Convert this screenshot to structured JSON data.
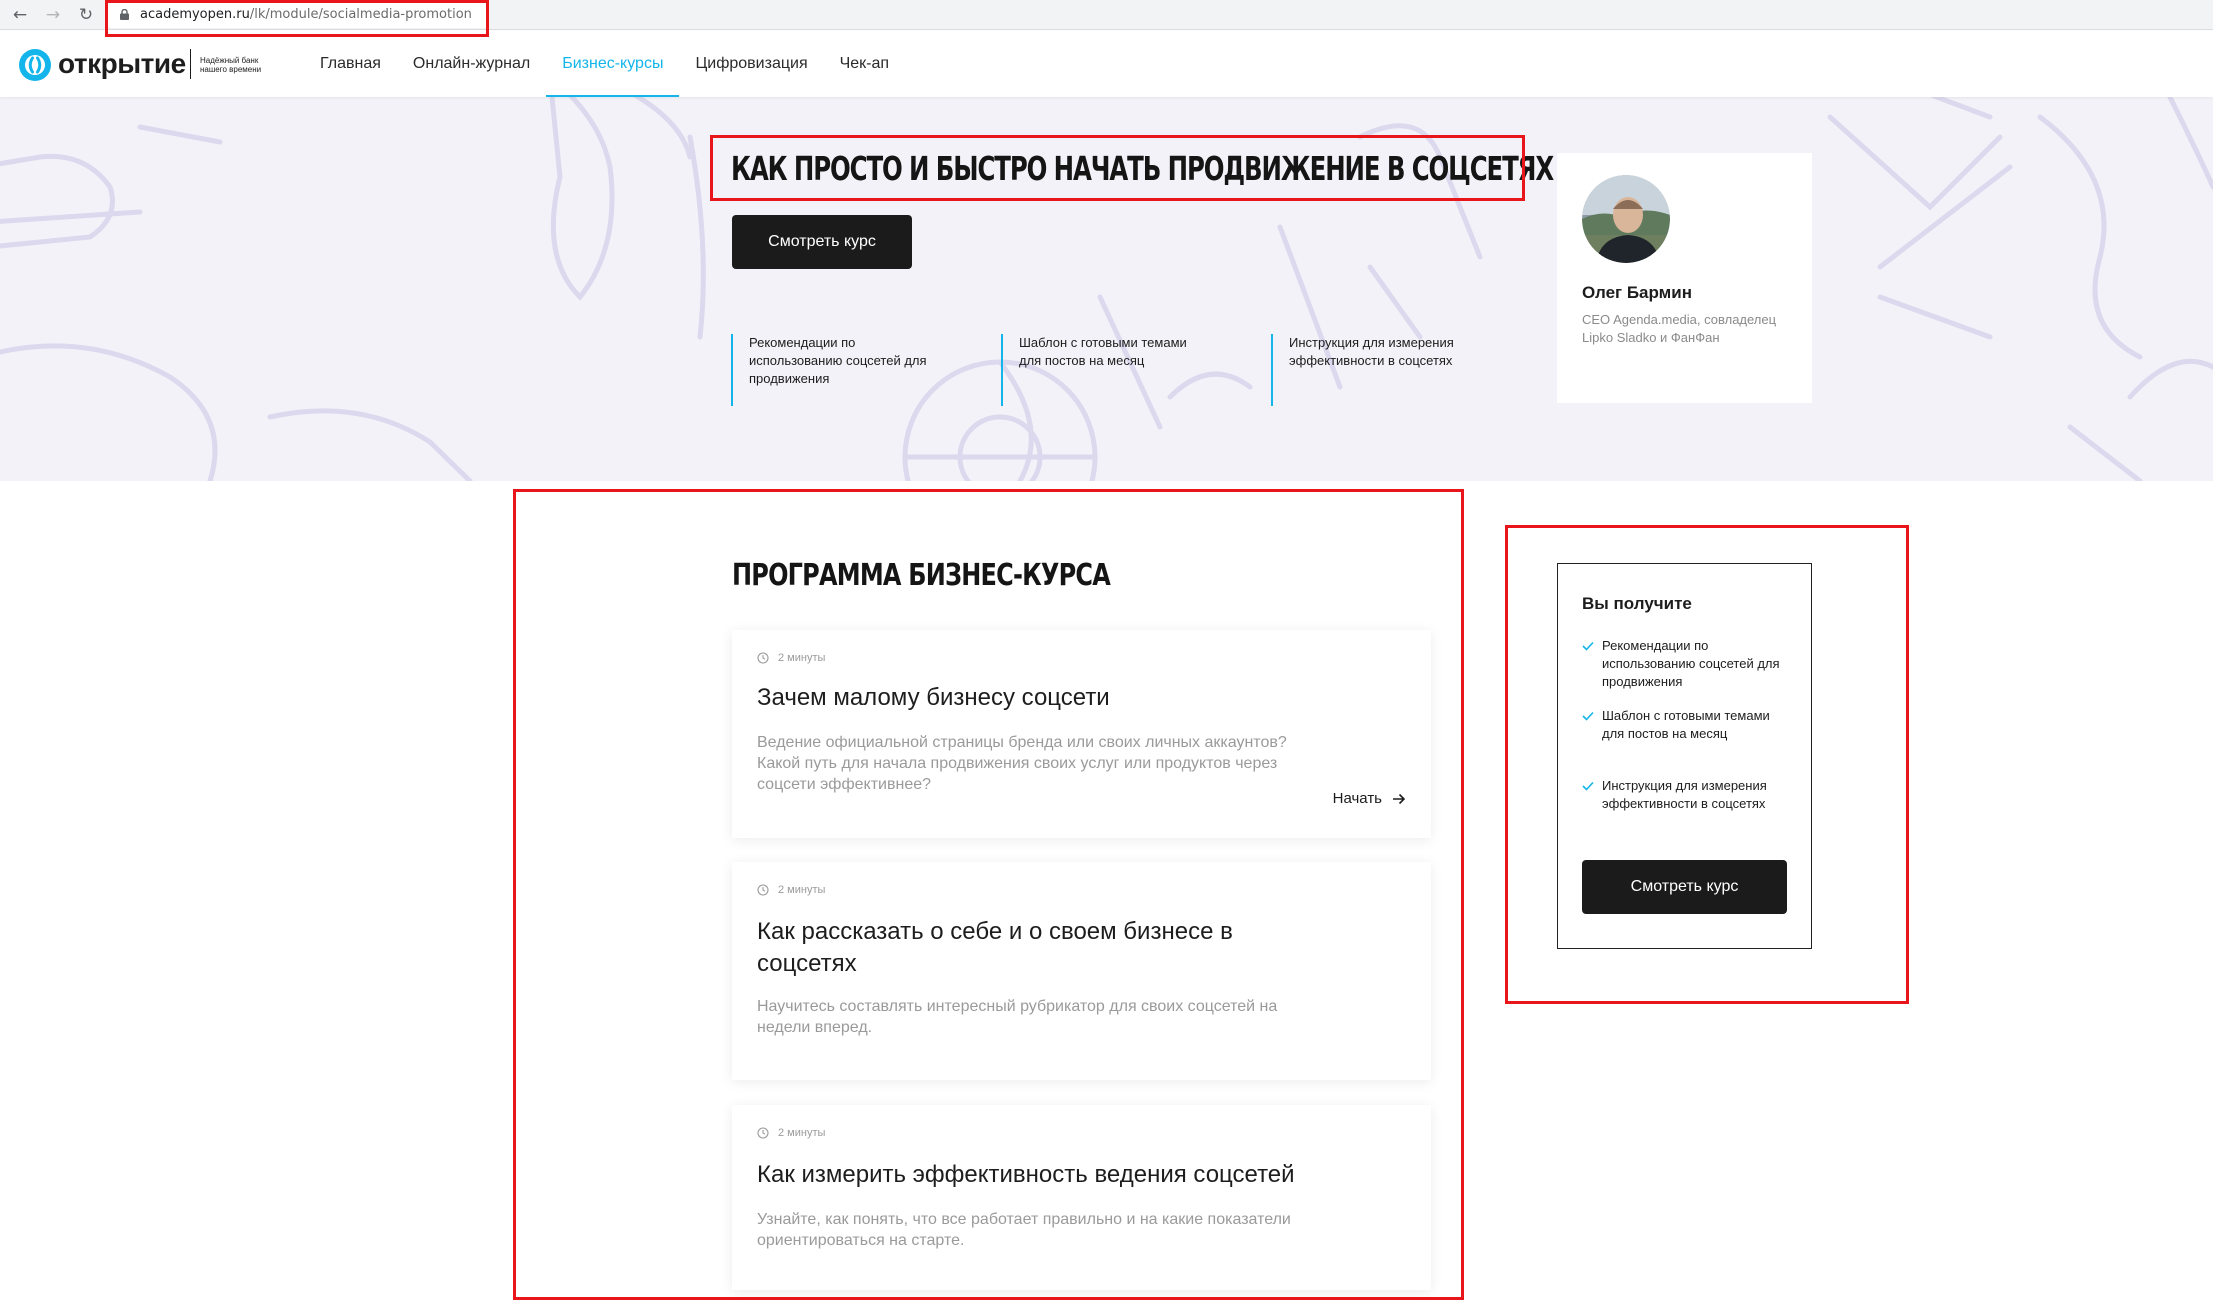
{
  "browser": {
    "url_domain": "academyopen.ru",
    "url_path": "/lk/module/socialmedia-promotion"
  },
  "header": {
    "logo_text": "открытие",
    "logo_tagline": "Надёжный банк нашего времени",
    "nav": [
      "Главная",
      "Онлайн-журнал",
      "Бизнес-курсы",
      "Цифровизация",
      "Чек-ап"
    ],
    "active_nav": "Бизнес-курсы"
  },
  "hero": {
    "title": "КАК ПРОСТО И БЫСТРО НАЧАТЬ ПРОДВИЖЕНИЕ В СОЦСЕТЯХ",
    "button_label": "Смотреть курс",
    "features": [
      "Рекомендации по использованию соцсетей для продвижения",
      "Шаблон с готовыми темами для постов на месяц",
      "Инструкция для измерения эффективности в соцсетях"
    ]
  },
  "author": {
    "name": "Олег Бармин",
    "role": "CEO Agenda.media, совладелец Lipko Sladko и ФанФан"
  },
  "program": {
    "title": "ПРОГРАММА БИЗНЕС-КУРСА",
    "lessons": [
      {
        "duration": "2 минуты",
        "title": "Зачем малому бизнесу соцсети",
        "description": "Ведение официальной страницы бренда или своих личных аккаунтов? Какой путь для начала продвижения своих услуг или продуктов через соцсети эффективнее?",
        "action": "Начать"
      },
      {
        "duration": "2 минуты",
        "title": "Как рассказать о себе и о своем бизнесе в соцсетях",
        "description": "Научитесь составлять интересный рубрикатор для своих соцсетей на недели вперед."
      },
      {
        "duration": "2 минуты",
        "title": "Как измерить эффективность ведения соцсетей",
        "description": "Узнайте, как понять, что все работает правильно и на какие показатели ориентироваться на старте."
      }
    ]
  },
  "benefits": {
    "title": "Вы получите",
    "items": [
      "Рекомендации по использованию соцсетей для продвижения",
      "Шаблон с готовыми темами для постов на месяц",
      "Инструкция для измерения эффективности в соцсетях"
    ],
    "button_label": "Смотреть курс"
  },
  "colors": {
    "accent": "#13b5ea",
    "hero_bg": "#f3f2f8",
    "button_bg": "#1b1b1b",
    "annotation_red": "#e8151b"
  },
  "icons": [
    "back-arrow-icon",
    "forward-arrow-icon",
    "reload-icon",
    "lock-icon",
    "clock-icon",
    "arrow-right-icon",
    "check-icon"
  ]
}
